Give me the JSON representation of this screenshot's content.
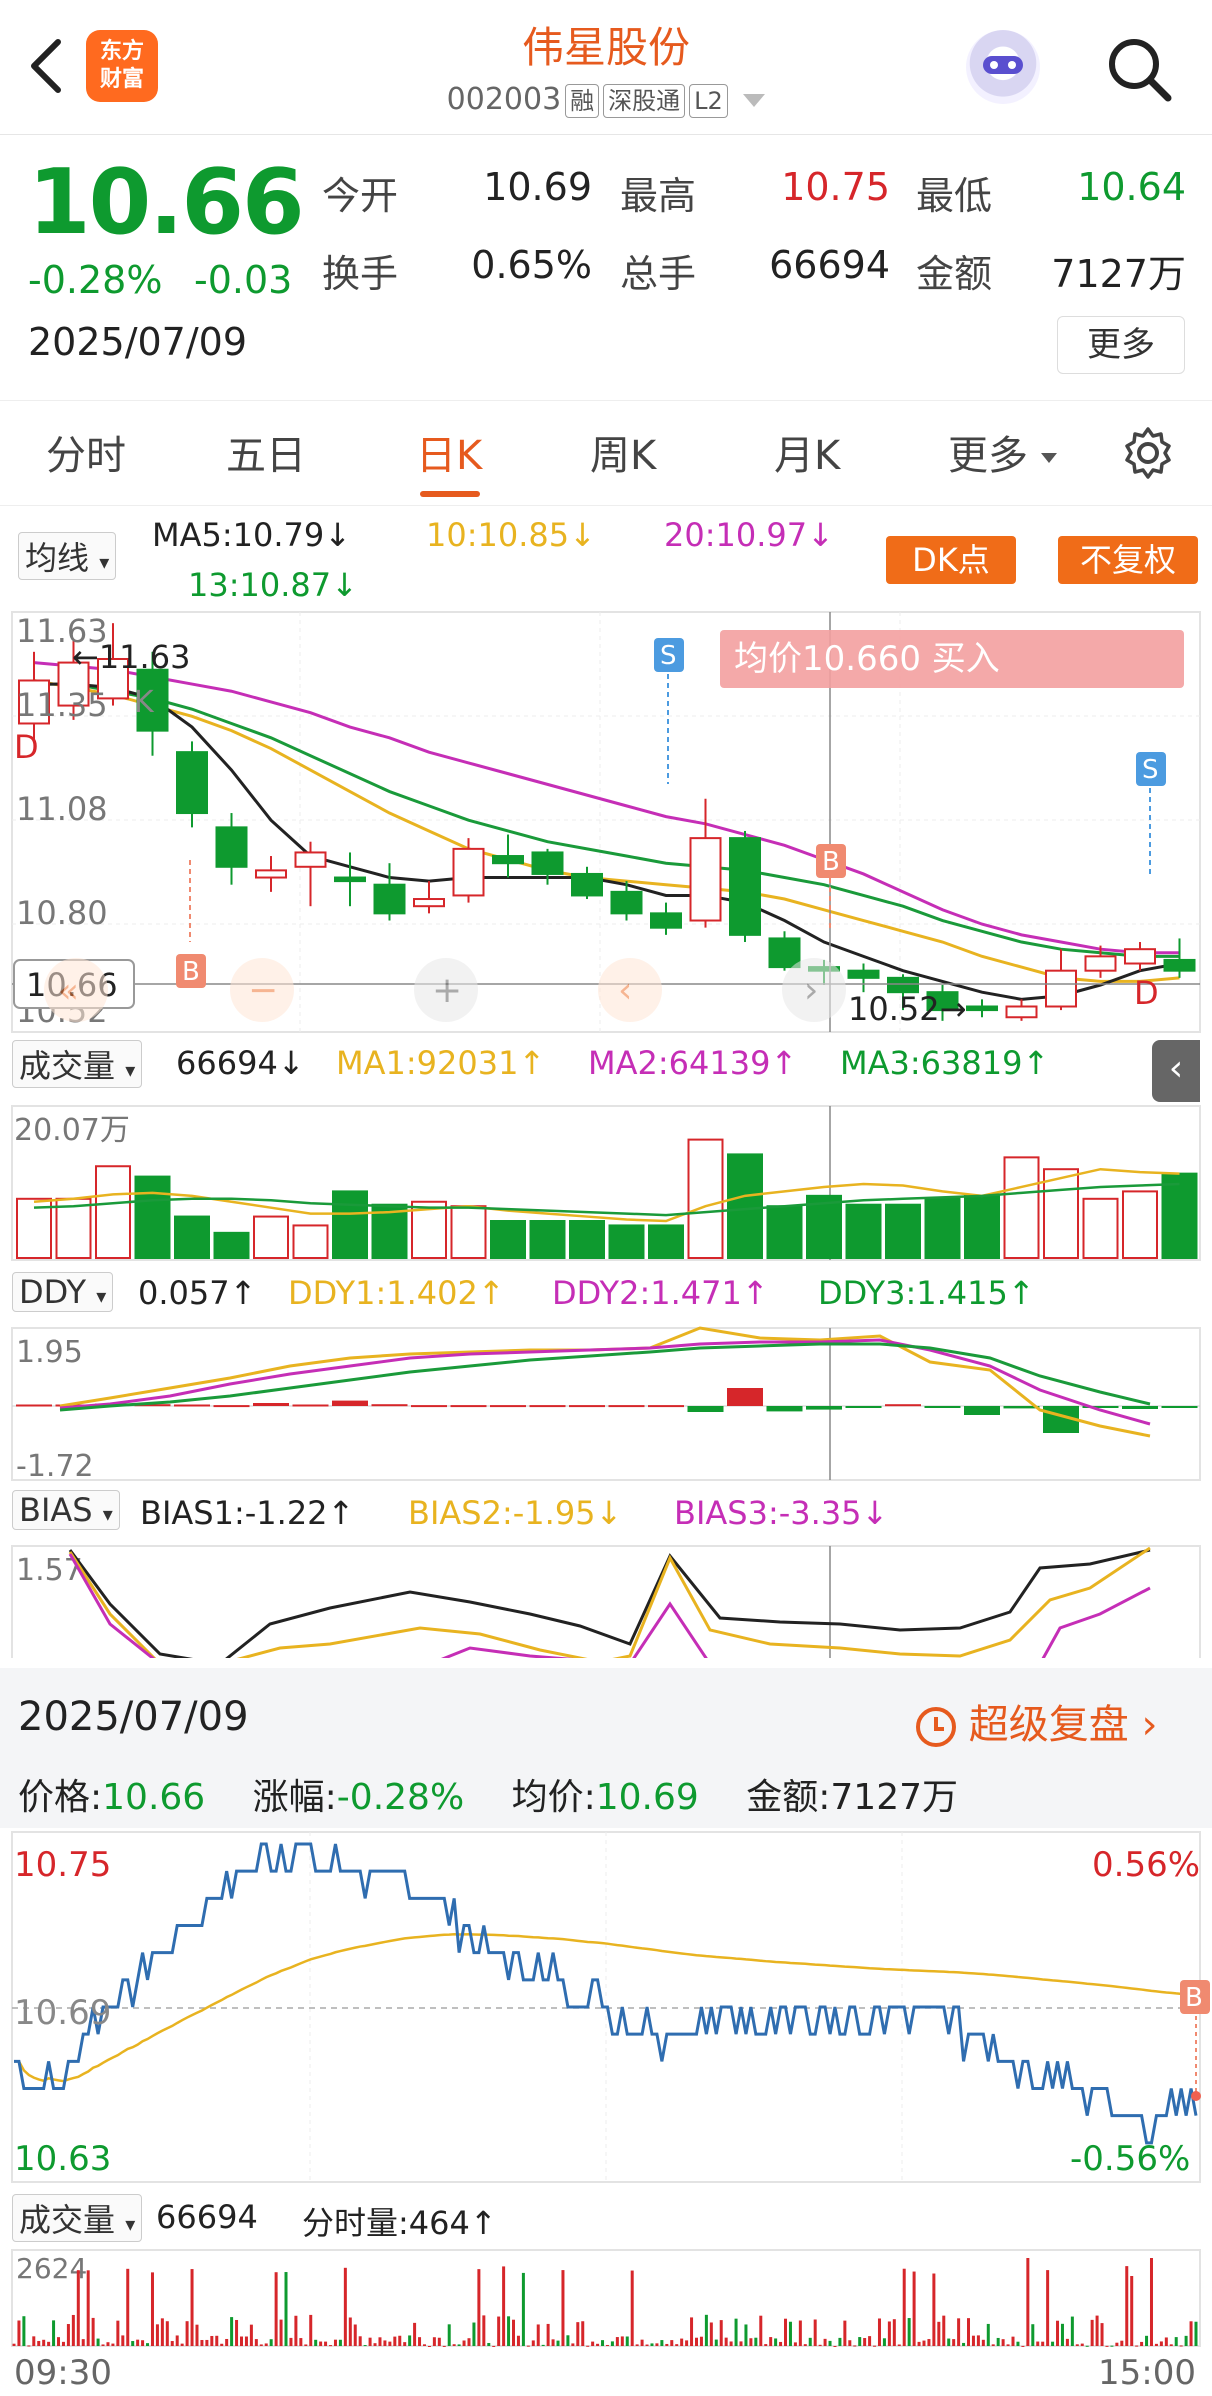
{
  "header": {
    "logo_text": "东方财富",
    "stock_name": "伟星股份",
    "stock_code": "002003",
    "tags": [
      "融",
      "深股通",
      "L2"
    ]
  },
  "quote": {
    "price": "10.66",
    "change_pct": "-0.28%",
    "change": "-0.03",
    "date": "2025/07/09",
    "fields": [
      {
        "label": "今开",
        "value": "10.69",
        "color": "dark"
      },
      {
        "label": "最高",
        "value": "10.75",
        "color": "red"
      },
      {
        "label": "最低",
        "value": "10.64",
        "color": "green"
      },
      {
        "label": "换手",
        "value": "0.65%",
        "color": "dark"
      },
      {
        "label": "总手",
        "value": "66694",
        "color": "dark"
      },
      {
        "label": "金额",
        "value": "7127万",
        "color": "dark"
      }
    ],
    "more_label": "更多"
  },
  "tabs": [
    {
      "label": "分时",
      "active": false
    },
    {
      "label": "五日",
      "active": false
    },
    {
      "label": "日K",
      "active": true
    },
    {
      "label": "周K",
      "active": false
    },
    {
      "label": "月K",
      "active": false
    },
    {
      "label": "更多",
      "active": false
    }
  ],
  "kline": {
    "ma_select": "均线",
    "ma5": "MA5:10.79↓",
    "ma10": "10:10.85↓",
    "ma20": "20:10.97↓",
    "ma13": "13:10.87↓",
    "dk_label": "DK点",
    "fq_label": "不复权",
    "y_labels": [
      "11.63",
      "11.35",
      "11.08",
      "10.80",
      "10.66",
      "10.52"
    ],
    "high_marker": "11.63",
    "low_marker": "10.52",
    "avg_banner": "均价10.660  买入",
    "marker_b": "B",
    "marker_s": "S",
    "marker_d": "D",
    "marker_k": "K",
    "candles": [
      {
        "o": 11.35,
        "c": 11.47,
        "h": 11.55,
        "l": 11.3
      },
      {
        "o": 11.4,
        "c": 11.52,
        "h": 11.58,
        "l": 11.36
      },
      {
        "o": 11.42,
        "c": 11.53,
        "h": 11.63,
        "l": 11.4
      },
      {
        "o": 11.5,
        "c": 11.33,
        "h": 11.55,
        "l": 11.26
      },
      {
        "o": 11.27,
        "c": 11.1,
        "h": 11.3,
        "l": 11.06
      },
      {
        "o": 11.06,
        "c": 10.95,
        "h": 11.1,
        "l": 10.9
      },
      {
        "o": 10.92,
        "c": 10.94,
        "h": 10.98,
        "l": 10.88
      },
      {
        "o": 10.95,
        "c": 10.99,
        "h": 11.02,
        "l": 10.84
      },
      {
        "o": 10.92,
        "c": 10.91,
        "h": 10.99,
        "l": 10.84
      },
      {
        "o": 10.9,
        "c": 10.82,
        "h": 10.96,
        "l": 10.8
      },
      {
        "o": 10.84,
        "c": 10.86,
        "h": 10.91,
        "l": 10.82
      },
      {
        "o": 10.87,
        "c": 11.0,
        "h": 11.03,
        "l": 10.85
      },
      {
        "o": 10.98,
        "c": 10.96,
        "h": 11.04,
        "l": 10.92
      },
      {
        "o": 10.99,
        "c": 10.93,
        "h": 11.0,
        "l": 10.9
      },
      {
        "o": 10.93,
        "c": 10.87,
        "h": 10.95,
        "l": 10.86
      },
      {
        "o": 10.88,
        "c": 10.82,
        "h": 10.91,
        "l": 10.8
      },
      {
        "o": 10.82,
        "c": 10.78,
        "h": 10.85,
        "l": 10.76
      },
      {
        "o": 10.8,
        "c": 11.03,
        "h": 11.14,
        "l": 10.78
      },
      {
        "o": 11.03,
        "c": 10.76,
        "h": 11.05,
        "l": 10.74
      },
      {
        "o": 10.75,
        "c": 10.67,
        "h": 10.77,
        "l": 10.66
      },
      {
        "o": 10.67,
        "c": 10.66,
        "h": 10.69,
        "l": 10.62
      },
      {
        "o": 10.66,
        "c": 10.64,
        "h": 10.68,
        "l": 10.6
      },
      {
        "o": 10.64,
        "c": 10.6,
        "h": 10.65,
        "l": 10.55
      },
      {
        "o": 10.6,
        "c": 10.55,
        "h": 10.62,
        "l": 10.52
      },
      {
        "o": 10.56,
        "c": 10.55,
        "h": 10.58,
        "l": 10.53
      },
      {
        "o": 10.53,
        "c": 10.56,
        "h": 10.58,
        "l": 10.52
      },
      {
        "o": 10.56,
        "c": 10.66,
        "h": 10.72,
        "l": 10.55
      },
      {
        "o": 10.66,
        "c": 10.7,
        "h": 10.73,
        "l": 10.64
      },
      {
        "o": 10.68,
        "c": 10.72,
        "h": 10.74,
        "l": 10.66
      },
      {
        "o": 10.69,
        "c": 10.66,
        "h": 10.75,
        "l": 10.64
      }
    ],
    "ma_lines": {
      "ma5": [
        11.46,
        11.46,
        11.45,
        11.42,
        11.34,
        11.22,
        11.08,
        10.98,
        10.95,
        10.92,
        10.91,
        10.92,
        10.92,
        10.92,
        10.92,
        10.9,
        10.87,
        10.87,
        10.85,
        10.8,
        10.74,
        10.7,
        10.66,
        10.63,
        10.6,
        10.58,
        10.59,
        10.62,
        10.66,
        10.68
      ],
      "ma10": [
        11.47,
        11.45,
        11.43,
        11.4,
        11.37,
        11.33,
        11.28,
        11.22,
        11.16,
        11.1,
        11.05,
        11.0,
        10.97,
        10.94,
        10.92,
        10.91,
        10.9,
        10.89,
        10.88,
        10.86,
        10.83,
        10.8,
        10.77,
        10.74,
        10.7,
        10.67,
        10.64,
        10.63,
        10.63,
        10.64
      ],
      "ma13": [
        11.46,
        11.46,
        11.44,
        11.42,
        11.39,
        11.35,
        11.31,
        11.26,
        11.21,
        11.16,
        11.12,
        11.08,
        11.05,
        11.02,
        11.0,
        10.98,
        10.96,
        10.95,
        10.94,
        10.92,
        10.9,
        10.87,
        10.84,
        10.8,
        10.77,
        10.74,
        10.72,
        10.71,
        10.7,
        10.7
      ],
      "ma20": [
        11.52,
        11.51,
        11.5,
        11.48,
        11.46,
        11.44,
        11.41,
        11.38,
        11.34,
        11.31,
        11.27,
        11.24,
        11.21,
        11.18,
        11.15,
        11.12,
        11.09,
        11.07,
        11.04,
        11.01,
        10.97,
        10.93,
        10.88,
        10.83,
        10.79,
        10.76,
        10.74,
        10.72,
        10.71,
        10.71
      ]
    }
  },
  "volume": {
    "select": "成交量",
    "value": "66694↓",
    "ma1": "MA1:92031↑",
    "ma2": "MA2:64139↑",
    "ma3": "MA3:63819↑",
    "y_max_label": "20.07万",
    "bars": [
      0.4,
      0.4,
      0.62,
      0.55,
      0.28,
      0.17,
      0.28,
      0.22,
      0.45,
      0.36,
      0.38,
      0.35,
      0.25,
      0.25,
      0.25,
      0.22,
      0.22,
      0.8,
      0.7,
      0.35,
      0.42,
      0.36,
      0.36,
      0.4,
      0.42,
      0.68,
      0.6,
      0.4,
      0.45,
      0.57
    ],
    "ma1_line": [
      0.38,
      0.4,
      0.43,
      0.44,
      0.42,
      0.38,
      0.34,
      0.3,
      0.3,
      0.31,
      0.33,
      0.35,
      0.32,
      0.3,
      0.28,
      0.26,
      0.25,
      0.35,
      0.42,
      0.45,
      0.48,
      0.5,
      0.49,
      0.45,
      0.42,
      0.48,
      0.54,
      0.6,
      0.58,
      0.57
    ],
    "ma3_line": [
      0.34,
      0.35,
      0.37,
      0.39,
      0.4,
      0.4,
      0.39,
      0.37,
      0.36,
      0.35,
      0.34,
      0.34,
      0.33,
      0.32,
      0.31,
      0.3,
      0.29,
      0.31,
      0.33,
      0.35,
      0.37,
      0.39,
      0.4,
      0.41,
      0.42,
      0.44,
      0.46,
      0.48,
      0.49,
      0.5
    ]
  },
  "ddy": {
    "select": "DDY",
    "value": "0.057↑",
    "ddy1": "DDY1:1.402↑",
    "ddy2": "DDY2:1.471↑",
    "ddy3": "DDY3:1.415↑",
    "y_top": "1.95",
    "y_bottom": "-1.72",
    "bars": [
      0.05,
      0.05,
      0.08,
      0.06,
      0.05,
      0.03,
      0.1,
      0.05,
      0.18,
      0.06,
      0.03,
      0.03,
      0.03,
      0.03,
      0.03,
      0.03,
      0.03,
      -0.2,
      0.6,
      -0.18,
      -0.12,
      -0.05,
      0.06,
      -0.06,
      -0.3,
      -0.08,
      -0.9,
      -0.05,
      -0.1,
      -0.05
    ]
  },
  "bias": {
    "select": "BIAS",
    "b1": "BIAS1:-1.22↑",
    "b2": "BIAS2:-1.95↓",
    "b3": "BIAS3:-3.35↓",
    "y_top": "1.57"
  },
  "intraday": {
    "date": "2025/07/09",
    "replay_label": "超级复盘",
    "price_label": "价格:",
    "price": "10.66",
    "pct_label": "涨幅:",
    "pct": "-0.28%",
    "avg_label": "均价:",
    "avg": "10.69",
    "amount_label": "金额:",
    "amount": "7127万",
    "y_high": "10.75",
    "y_mid": "10.69",
    "y_low": "10.63",
    "pct_high": "0.56%",
    "pct_low": "-0.56%",
    "marker_b": "B",
    "vol_select": "成交量",
    "vol_value": "66694",
    "vol_now": "分时量:464↑",
    "vol_max": "2624",
    "time_start": "09:30",
    "time_end": "15:00"
  },
  "colors": {
    "up": "#d6262a",
    "down": "#0e9a2f",
    "ma5": "#222222",
    "ma10": "#e8b320",
    "ma13": "#1a9a3a",
    "ma20": "#c52eb6",
    "accent": "#e65a1e",
    "intraday_line": "#2f6db0",
    "avg_line": "#e8b320"
  }
}
